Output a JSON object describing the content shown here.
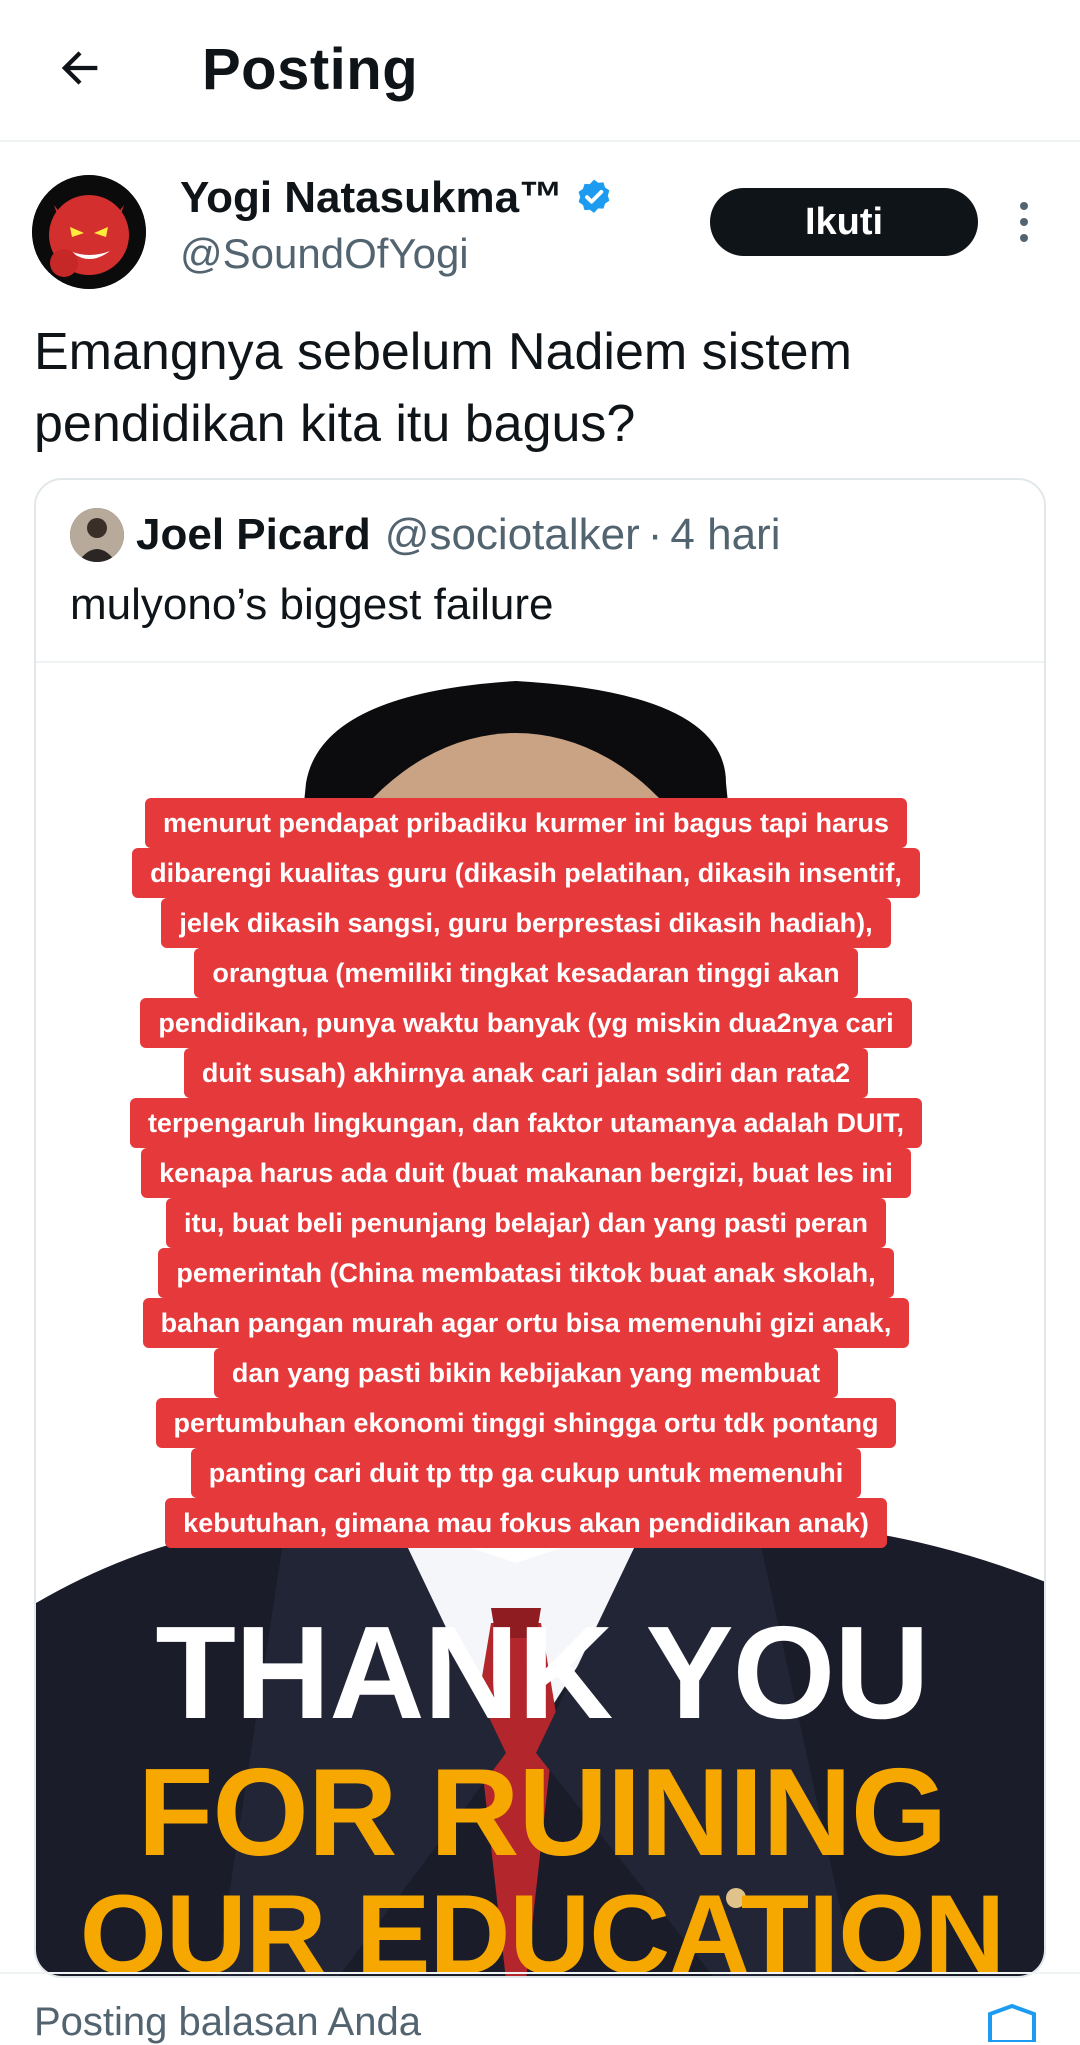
{
  "header": {
    "title": "Posting",
    "back_icon": "arrow-left-icon"
  },
  "tweet": {
    "author_name": "Yogi Natasukma™",
    "author_handle": "@SoundOfYogi",
    "verified_icon": "verified-badge-icon",
    "follow_label": "Ikuti",
    "more_icon": "more-vertical-icon",
    "text": "Emangnya sebelum Nadiem sistem pendidikan kita itu bagus?"
  },
  "quote": {
    "author_name": "Joel Picard",
    "author_handle": "@sociotalker",
    "separator": "·",
    "time": "4 hari",
    "text": "mulyono’s biggest failure"
  },
  "media": {
    "overlay_lines": [
      "menurut pendapat pribadiku kurmer ini bagus tapi harus",
      "dibarengi kualitas guru (dikasih pelatihan, dikasih insentif,",
      "jelek dikasih sangsi, guru berprestasi dikasih hadiah),",
      "orangtua (memiliki tingkat kesadaran tinggi akan",
      "pendidikan, punya waktu banyak (yg miskin dua2nya cari",
      "duit susah) akhirnya anak cari jalan sdiri dan rata2",
      "terpengaruh lingkungan, dan faktor utamanya adalah DUIT,",
      "kenapa harus ada duit (buat makanan bergizi, buat les ini",
      "itu, buat beli penunjang belajar) dan yang pasti peran",
      "pemerintah (China membatasi tiktok buat anak skolah,",
      "bahan pangan murah agar ortu bisa memenuhi gizi anak,",
      "dan yang pasti bikin kebijakan yang membuat",
      "pertumbuhan ekonomi tinggi shingga ortu tdk pontang",
      "panting cari duit tp ttp ga cukup untuk memenuhi",
      "kebutuhan, gimana mau fokus akan pendidikan anak)"
    ],
    "headline_1": "THANK YOU",
    "headline_2": "FOR RUINING",
    "headline_3": "OUR EDUCATION",
    "overlay_color": "#e5393c",
    "headline_accent": "#f6a800"
  },
  "footer": {
    "text": "Posting balasan Anda",
    "icon": "shield-icon"
  }
}
